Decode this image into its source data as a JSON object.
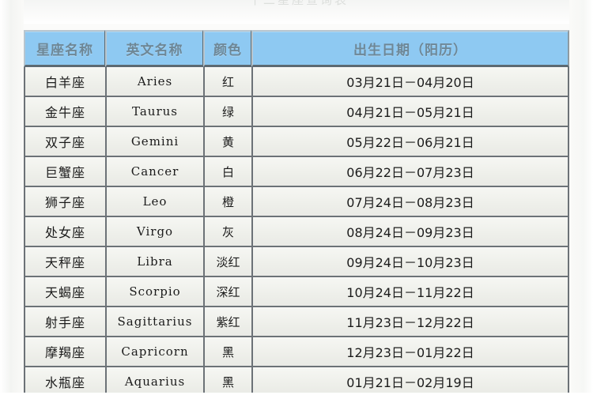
{
  "page": {
    "title_ghost": "十二星座查询表",
    "background_color": "#fbfbfa",
    "header_color": "#8ec9f2",
    "cell_color": "#f1f2ee",
    "grid_color": "#6c7277"
  },
  "table": {
    "columns": [
      {
        "key": "name",
        "label": "星座名称"
      },
      {
        "key": "en",
        "label": "英文名称"
      },
      {
        "key": "color",
        "label": "颜色"
      },
      {
        "key": "date",
        "label": "出生日期（阳历）"
      }
    ],
    "rows": [
      {
        "name": "白羊座",
        "en": "Aries",
        "color": "红",
        "date": "03月21日－04月20日"
      },
      {
        "name": "金牛座",
        "en": "Taurus",
        "color": "绿",
        "date": "04月21日－05月21日"
      },
      {
        "name": "双子座",
        "en": "Gemini",
        "color": "黄",
        "date": "05月22日－06月21日"
      },
      {
        "name": "巨蟹座",
        "en": "Cancer",
        "color": "白",
        "date": "06月22日－07月23日"
      },
      {
        "name": "狮子座",
        "en": "Leo",
        "color": "橙",
        "date": "07月24日－08月23日"
      },
      {
        "name": "处女座",
        "en": "Virgo",
        "color": "灰",
        "date": "08月24日－09月23日"
      },
      {
        "name": "天秤座",
        "en": "Libra",
        "color": "淡红",
        "date": "09月24日－10月23日"
      },
      {
        "name": "天蝎座",
        "en": "Scorpio",
        "color": "深红",
        "date": "10月24日－11月22日"
      },
      {
        "name": "射手座",
        "en": "Sagittarius",
        "color": "紫红",
        "date": "11月23日－12月22日"
      },
      {
        "name": "摩羯座",
        "en": "Capricorn",
        "color": "黑",
        "date": "12月23日－01月22日"
      },
      {
        "name": "水瓶座",
        "en": "Aquarius",
        "color": "黑",
        "date": "01月21日－02月19日"
      }
    ]
  }
}
